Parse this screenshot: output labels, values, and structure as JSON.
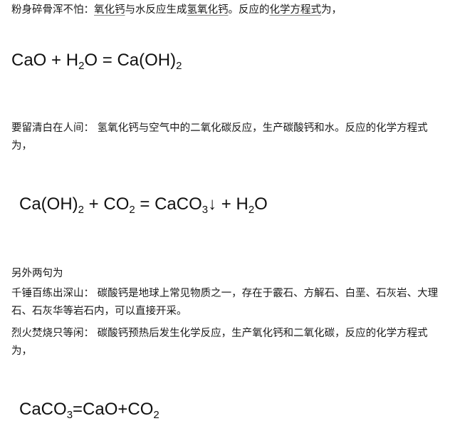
{
  "section1": {
    "prefix": "粉身碎骨浑不怕：",
    "link_cao": "氧化钙",
    "middle1": "与水反应生成",
    "link_caoh2": "氢氧化钙",
    "middle2": "。反应的",
    "link_eq": "化学方程式",
    "suffix": "为，"
  },
  "eq1": {
    "r1": "CaO",
    "plus": " + ",
    "r2_base": "H",
    "r2_sub": "2",
    "r2_tail": "O",
    "equals": " = ",
    "p1_base": "Ca(OH)",
    "p1_sub": "2"
  },
  "section2": {
    "text": "要留清白在人间： 氢氧化钙与空气中的二氧化碳反应，生产碳酸钙和水。反应的化学方程式为，"
  },
  "eq2": {
    "r1_base": "Ca(OH)",
    "r1_sub": "2",
    "plus1": " + ",
    "r2_base": "CO",
    "r2_sub": "2",
    "equals": " = ",
    "p1_base": "CaCO",
    "p1_sub": "3",
    "p1_arrow": "↓",
    "plus2": " + ",
    "p2_base": "H",
    "p2_sub": "2",
    "p2_tail": "O"
  },
  "section3": {
    "heading": "另外两句为",
    "line1": "千锤百练出深山： 碳酸钙是地球上常见物质之一，存在于霰石、方解石、白垩、石灰岩、大理石、石灰华等岩石内，可以直接开采。",
    "line2": "烈火焚烧只等闲： 碳酸钙预热后发生化学反应，生产氧化钙和二氧化碳，反应的化学方程式为，"
  },
  "eq3": {
    "r1_base": "CaCO",
    "r1_sub": "3",
    "equals": "=",
    "p1": "CaO",
    "plus": "+",
    "p2_base": "CO",
    "p2_sub": "2"
  }
}
